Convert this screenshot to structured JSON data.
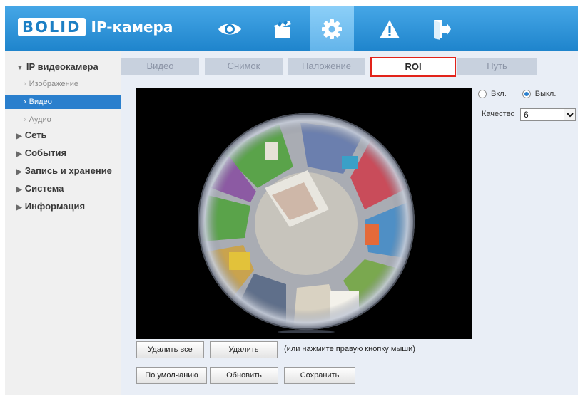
{
  "header": {
    "logo_brand": "BOLID",
    "logo_text": "IP-камера",
    "nav_icons": [
      "eye-icon",
      "clapper-icon",
      "gear-icon",
      "warning-icon",
      "exit-icon"
    ],
    "active_nav": "gear-icon",
    "colors": {
      "bar": "#2b91d6",
      "active": "#7cc4f3"
    }
  },
  "sidebar": {
    "groups": [
      {
        "label": "IP видеокамера",
        "expanded": true,
        "items": [
          {
            "label": "Изображение",
            "active": false
          },
          {
            "label": "Видео",
            "active": true
          },
          {
            "label": "Аудио",
            "active": false
          }
        ]
      },
      {
        "label": "Сеть",
        "expanded": false
      },
      {
        "label": "События",
        "expanded": false
      },
      {
        "label": "Запись и хранение",
        "expanded": false
      },
      {
        "label": "Система",
        "expanded": false
      },
      {
        "label": "Информация",
        "expanded": false
      }
    ]
  },
  "tabs": [
    {
      "label": "Видео",
      "selected": false
    },
    {
      "label": "Снимок",
      "selected": false
    },
    {
      "label": "Наложение",
      "selected": false
    },
    {
      "label": "ROI",
      "selected": true
    },
    {
      "label": "Путь",
      "selected": false
    }
  ],
  "roi": {
    "radio_on_label": "Вкл.",
    "radio_off_label": "Выкл.",
    "selected": "off",
    "quality_label": "Качество",
    "quality_value": "6"
  },
  "buttons": {
    "delete_all": "Удалить все",
    "delete": "Удалить",
    "hint": "(или нажмите правую кнопку мыши)",
    "default": "По умолчанию",
    "refresh": "Обновить",
    "save": "Сохранить"
  },
  "colors": {
    "selected_tab_border": "#e2231a",
    "sidebar_active": "#2a7fcd"
  }
}
